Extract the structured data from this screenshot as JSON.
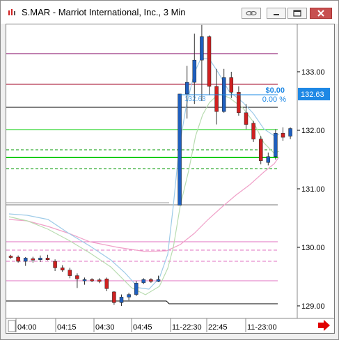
{
  "window": {
    "title": "S.MAR - Marriot International, Inc., 3 Min"
  },
  "icons": {
    "app": "chart-app-icon",
    "link": "link-icon",
    "minimize": "minimize-icon",
    "maximize": "maximize-icon",
    "close": "close-icon",
    "scroll": "scroll-right-arrow-icon"
  },
  "colors": {
    "up_candle": "#1f5fbf",
    "down_candle": "#d02020",
    "current_price_box": "#1e88e5",
    "ma_fast": "#9ecbe8",
    "ma_mid": "#b8dcb0",
    "ma_slow": "#f0a0c8",
    "level_green": "#00cc00",
    "level_purple": "#800060",
    "level_darkred": "#a00020",
    "level_pink": "#e070c0",
    "level_black": "#000000"
  },
  "price_axis": {
    "labels": [
      "133.00",
      "132.00",
      "131.00",
      "130.00",
      "129.00"
    ],
    "current_price": "132.63"
  },
  "time_axis": {
    "labels": [
      "04:00",
      "04:15",
      "04:30",
      "04:45",
      "11-22:30",
      "22:45",
      "11-23:00"
    ]
  },
  "position_overlay": {
    "pnl": "$0.00",
    "pct": "0.00 %",
    "entry_label": "132.63"
  },
  "chart_data": {
    "type": "candlestick",
    "ylim": [
      128.9,
      133.9
    ],
    "candles": [
      {
        "o": 129.58,
        "h": 129.62,
        "l": 129.5,
        "c": 129.55
      },
      {
        "o": 129.55,
        "h": 129.6,
        "l": 129.38,
        "c": 129.42
      },
      {
        "o": 129.42,
        "h": 129.55,
        "l": 129.28,
        "c": 129.52
      },
      {
        "o": 129.5,
        "h": 129.56,
        "l": 129.38,
        "c": 129.47
      },
      {
        "o": 129.47,
        "h": 129.6,
        "l": 129.4,
        "c": 129.52
      },
      {
        "o": 129.52,
        "h": 129.62,
        "l": 129.45,
        "c": 129.47
      },
      {
        "o": 129.42,
        "h": 129.48,
        "l": 129.12,
        "c": 129.22
      },
      {
        "o": 129.22,
        "h": 129.3,
        "l": 129.1,
        "c": 129.15
      },
      {
        "o": 129.15,
        "h": 129.22,
        "l": 128.9,
        "c": 128.98
      },
      {
        "o": 128.98,
        "h": 129.05,
        "l": 128.6,
        "c": 128.88
      },
      {
        "o": 128.82,
        "h": 128.92,
        "l": 128.7,
        "c": 128.86
      },
      {
        "o": 128.86,
        "h": 128.9,
        "l": 128.78,
        "c": 128.82
      },
      {
        "o": 128.85,
        "h": 128.9,
        "l": 128.75,
        "c": 128.8
      },
      {
        "o": 128.88,
        "h": 128.92,
        "l": 128.5,
        "c": 128.58
      },
      {
        "o": 128.48,
        "h": 128.5,
        "l": 128.08,
        "c": 128.15
      },
      {
        "o": 128.15,
        "h": 128.4,
        "l": 128.05,
        "c": 128.32
      },
      {
        "o": 128.32,
        "h": 128.45,
        "l": 128.22,
        "c": 128.4
      },
      {
        "o": 128.4,
        "h": 128.82,
        "l": 128.35,
        "c": 128.75
      },
      {
        "o": 128.76,
        "h": 128.9,
        "l": 128.72,
        "c": 128.86
      },
      {
        "o": 128.86,
        "h": 128.9,
        "l": 128.76,
        "c": 128.8
      },
      {
        "o": 128.8,
        "h": 128.98,
        "l": 128.78,
        "c": 128.86
      },
      {
        "o": 130.72,
        "h": 132.62,
        "l": 130.72,
        "c": 132.62
      },
      {
        "o": 132.62,
        "h": 133.1,
        "l": 132.2,
        "c": 132.82
      },
      {
        "o": 132.82,
        "h": 133.65,
        "l": 132.45,
        "c": 133.2
      },
      {
        "o": 133.2,
        "h": 133.8,
        "l": 132.5,
        "c": 133.6
      },
      {
        "o": 133.6,
        "h": 133.62,
        "l": 132.6,
        "c": 132.75
      },
      {
        "o": 132.75,
        "h": 133.05,
        "l": 132.1,
        "c": 132.32
      },
      {
        "o": 132.32,
        "h": 133.05,
        "l": 132.3,
        "c": 132.9
      },
      {
        "o": 132.9,
        "h": 133.0,
        "l": 132.55,
        "c": 132.65
      },
      {
        "o": 132.65,
        "h": 132.75,
        "l": 132.25,
        "c": 132.3
      },
      {
        "o": 132.3,
        "h": 132.45,
        "l": 132.02,
        "c": 132.1
      },
      {
        "o": 132.12,
        "h": 132.16,
        "l": 131.8,
        "c": 131.85
      },
      {
        "o": 131.85,
        "h": 131.9,
        "l": 131.42,
        "c": 131.48
      },
      {
        "o": 131.45,
        "h": 131.62,
        "l": 131.4,
        "c": 131.55
      },
      {
        "o": 131.55,
        "h": 132.02,
        "l": 131.5,
        "c": 131.95
      },
      {
        "o": 131.95,
        "h": 132.05,
        "l": 131.82,
        "c": 131.88
      },
      {
        "o": 131.9,
        "h": 132.05,
        "l": 131.85,
        "c": 132.03
      }
    ]
  }
}
